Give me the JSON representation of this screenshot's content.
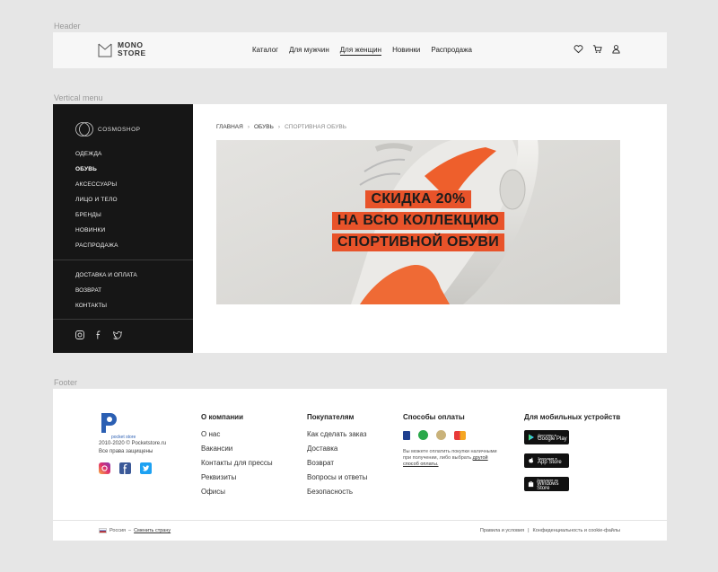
{
  "sections": {
    "header_label": "Header",
    "vertical_menu_label": "Vertical menu",
    "footer_label": "Footer"
  },
  "header": {
    "logo_line1": "MONO",
    "logo_line2": "STORE",
    "nav": [
      "Каталог",
      "Для мужчин",
      "Для женщин",
      "Новинки",
      "Распродажа"
    ],
    "active_nav_index": 2,
    "icons": [
      "heart-icon",
      "cart-icon",
      "user-icon"
    ]
  },
  "sidebar": {
    "logo_text": "COSMOSHOP",
    "menu": [
      "ОДЕЖДА",
      "ОБУВЬ",
      "АКСЕССУАРЫ",
      "ЛИЦО И ТЕЛО",
      "БРЕНДЫ",
      "НОВИНКИ",
      "РАСПРОДАЖА"
    ],
    "active_index": 1,
    "menu2": [
      "ДОСТАВКА И ОПЛАТА",
      "ВОЗВРАТ",
      "КОНТАКТЫ"
    ],
    "social": [
      "instagram-icon",
      "facebook-icon",
      "twitter-icon"
    ]
  },
  "breadcrumb": [
    "ГЛАВНАЯ",
    "ОБУВЬ",
    "СПОРТИВНАЯ ОБУВЬ"
  ],
  "banner": {
    "line1": "СКИДКА 20%",
    "line2": "НА ВСЮ КОЛЛЕКЦИЮ",
    "line3": "СПОРТИВНОЙ ОБУВИ",
    "accent_color": "#e8532a"
  },
  "footer": {
    "brand": "pocket store",
    "copyright_line1": "2010-2020 © Pocketstore.ru",
    "copyright_line2": "Все права защищены",
    "social": [
      "instagram-icon",
      "facebook-icon",
      "twitter-icon"
    ],
    "col_company": {
      "title": "О компании",
      "items": [
        "О нас",
        "Вакансии",
        "Контакты для прессы",
        "Реквизиты",
        "Офисы"
      ]
    },
    "col_buyers": {
      "title": "Покупателям",
      "items": [
        "Как сделать заказ",
        "Доставка",
        "Возврат",
        "Вопросы и ответы",
        "Безопасность"
      ]
    },
    "col_payment": {
      "title": "Способы оплаты",
      "note": "Вы можете оплатить покупки наличными при получении, либо выбрать",
      "note_link": "другой способ оплаты."
    },
    "col_mobile": {
      "title": "Для мобильных устройств",
      "stores": [
        {
          "small": "Доступно в",
          "big": "Google Play"
        },
        {
          "small": "Загрузите в",
          "big": "App Store"
        },
        {
          "small": "Загрузите из",
          "big": "Windows Store"
        }
      ]
    },
    "country": "Россия",
    "change_country": "Сменить страну",
    "legal1": "Правила и условия",
    "legal2": "Конфиденциальность и cookie-файлы"
  }
}
